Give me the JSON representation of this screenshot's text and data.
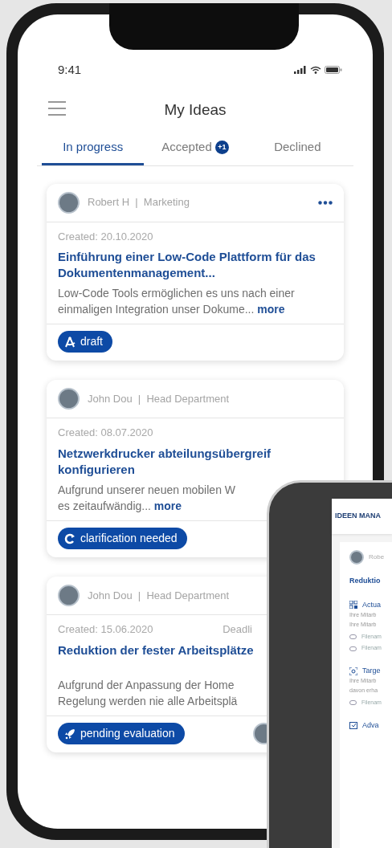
{
  "status_bar": {
    "time": "9:41"
  },
  "header": {
    "title": "My Ideas"
  },
  "tabs": [
    {
      "label": "In progress",
      "selected": true
    },
    {
      "label": "Accepted",
      "badge": "+1",
      "selected": false
    },
    {
      "label": "Declined",
      "selected": false
    }
  ],
  "cards": [
    {
      "byline": "Robert H  |  Marketing",
      "menu": true,
      "created": "Created: 20.10.2020",
      "title_lines": [
        "Einführung einer Low-Code Plattform für das",
        "Dokumentenmanagement..."
      ],
      "description_lines": [
        "Low-Code Tools ermöglichen es uns nach einer",
        "einmaligen Integration unser Dokume..."
      ],
      "more": "more",
      "status": {
        "kind": "draft",
        "label": "draft"
      },
      "assignee": false
    },
    {
      "byline": "John Dou  |  Head Department",
      "menu": false,
      "created": "Created: 08.07.2020",
      "title_lines": [
        "Netzwerkdrucker abteilungsübergreif",
        "konfigurieren"
      ],
      "description_lines": [
        "Aufgrund unserer neuen mobilen W",
        "es zeitaufwändig..."
      ],
      "more": "more",
      "status": {
        "kind": "clarification",
        "label": "clarification needed"
      },
      "assignee": false
    },
    {
      "byline": "John Dou  |  Head Department",
      "menu": false,
      "created": "Created: 15.06.2020",
      "deadline": "Deadli",
      "title_lines": [
        "Reduktion der fester Arbeitsplätze"
      ],
      "description_lines": [
        "Aufgrund der Anpassung der Home",
        "Regelung werden nie alle Arbeitsplä"
      ],
      "status": {
        "kind": "pending",
        "label": "pending evaluation"
      },
      "assignee": true
    }
  ],
  "tablet": {
    "header": "IDEEN MANA",
    "author": "Robe",
    "title": "Reduktio",
    "items": [
      {
        "kind": "section",
        "text": "Actua"
      },
      {
        "kind": "text",
        "text": "Ihre Mitarb"
      },
      {
        "kind": "text",
        "text": "Ihre Mitarb"
      },
      {
        "kind": "file",
        "text": "Filenam"
      },
      {
        "kind": "file",
        "text": "Filenam"
      },
      {
        "kind": "section",
        "text": "Targe"
      },
      {
        "kind": "text",
        "text": "Ihre Mitarb"
      },
      {
        "kind": "text",
        "text": "davon erha"
      },
      {
        "kind": "file",
        "text": "Filenam"
      },
      {
        "kind": "section",
        "text": "Adva"
      }
    ]
  }
}
